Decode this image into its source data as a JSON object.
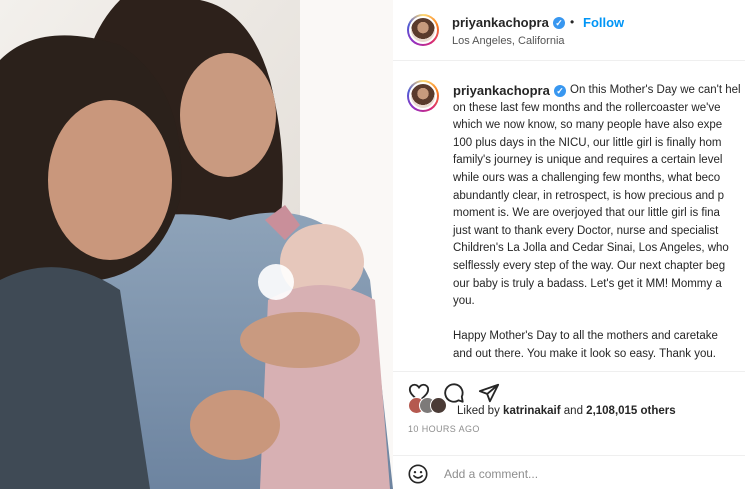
{
  "post": {
    "image_alt": "Family photo with newborn",
    "colors": {
      "accent": "#0095f6",
      "verified": "#3897f0",
      "muted": "#8e8e8e"
    }
  },
  "header": {
    "username": "priyankachopra",
    "separator": "•",
    "follow_label": "Follow",
    "location": "Los Angeles, California"
  },
  "caption": {
    "username": "priyankachopra",
    "text": "On this Mother's Day we can't hel\non these last few months and the rollercoaster we've\nwhich we now know, so many people have also expe\n100 plus days in the NICU, our little girl is finally hom\nfamily's journey is unique and requires a certain level\nwhile ours was a challenging few months, what beco\nabundantly clear, in retrospect, is how precious and p\nmoment is. We are overjoyed that our little girl is fina\njust want to thank every Doctor, nurse and specialist\nChildren's La Jolla and Cedar Sinai, Los Angeles, who\nselflessly every step of the way. Our next chapter beg\nour baby is truly a badass. Let's get it MM! Mommy a\nyou.\n\nHappy Mother's Day to all the mothers and caretake\nand out there. You make it look so easy. Thank you."
  },
  "actions": {
    "icons": [
      "heart-icon",
      "comment-icon",
      "share-icon"
    ],
    "liked_prefix": "Liked by",
    "liked_user": "katrinakaif",
    "liked_and": "and",
    "liked_count": "2,108,015 others",
    "timestamp": "10 HOURS AGO"
  },
  "comment": {
    "icon": "emoji-icon",
    "placeholder": "Add a comment..."
  }
}
